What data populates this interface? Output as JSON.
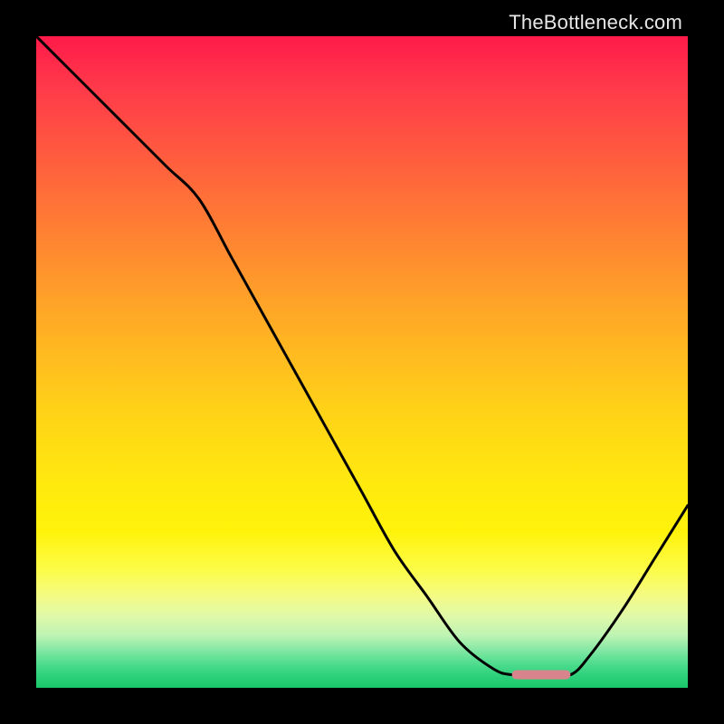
{
  "watermark": "TheBottleneck.com",
  "chart_data": {
    "type": "line",
    "title": "",
    "xlabel": "",
    "ylabel": "",
    "xlim": [
      0,
      100
    ],
    "ylim": [
      0,
      100
    ],
    "gradient_stops": [
      {
        "pct": 0,
        "color": "#ff1a4a"
      },
      {
        "pct": 8,
        "color": "#ff3a4a"
      },
      {
        "pct": 18,
        "color": "#ff5a3f"
      },
      {
        "pct": 28,
        "color": "#ff7a35"
      },
      {
        "pct": 38,
        "color": "#ff9a2b"
      },
      {
        "pct": 48,
        "color": "#ffb821"
      },
      {
        "pct": 58,
        "color": "#ffd317"
      },
      {
        "pct": 68,
        "color": "#ffe80f"
      },
      {
        "pct": 76,
        "color": "#fff30a"
      },
      {
        "pct": 82,
        "color": "#fcfc4a"
      },
      {
        "pct": 86,
        "color": "#f4fb86"
      },
      {
        "pct": 89,
        "color": "#e0f9a8"
      },
      {
        "pct": 92,
        "color": "#bdf3b3"
      },
      {
        "pct": 94,
        "color": "#8ae9a6"
      },
      {
        "pct": 96,
        "color": "#55de92"
      },
      {
        "pct": 98,
        "color": "#2fd27d"
      },
      {
        "pct": 100,
        "color": "#19c86a"
      }
    ],
    "series": [
      {
        "name": "bottleneck-curve",
        "color": "#000000",
        "stroke_width": 3,
        "x": [
          0,
          5,
          10,
          15,
          20,
          25,
          30,
          35,
          40,
          45,
          50,
          55,
          60,
          65,
          70,
          73,
          78,
          82,
          85,
          90,
          95,
          100
        ],
        "y": [
          100,
          95,
          90,
          85,
          80,
          75,
          66,
          57,
          48,
          39,
          30,
          21,
          14,
          7,
          3,
          2,
          2,
          2,
          5,
          12,
          20,
          28
        ]
      }
    ],
    "marker": {
      "name": "optimal-range",
      "color": "#d8848d",
      "shape": "rounded-bar",
      "x_start": 73,
      "x_end": 82,
      "y": 2,
      "height_pct": 1.4
    }
  }
}
